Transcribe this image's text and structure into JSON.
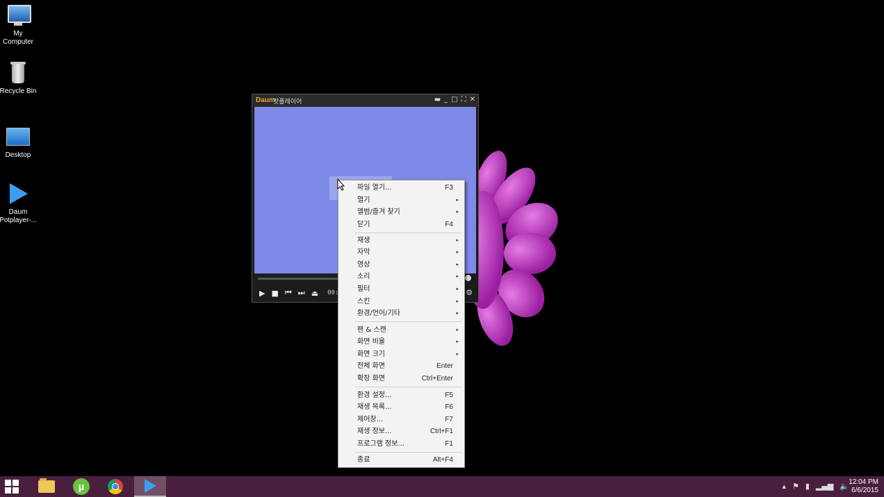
{
  "desktop": {
    "icons": [
      {
        "label1": "My",
        "label2": "Computer"
      },
      {
        "label1": "Recycle Bin",
        "label2": ""
      },
      {
        "label1": "Desktop",
        "label2": ""
      },
      {
        "label1": "Daum",
        "label2": "Potplayer-..."
      }
    ]
  },
  "player": {
    "title": "팟플레이어",
    "time": "00:00:0"
  },
  "menu": {
    "items": [
      {
        "label": "파일 열기...",
        "shortcut": "F3"
      },
      {
        "label": "열기",
        "arrow": "▸"
      },
      {
        "label": "앨범/즐겨 찾기",
        "arrow": "▸"
      },
      {
        "label": "닫기",
        "shortcut": "F4"
      },
      {
        "label": "재생",
        "arrow": "▸"
      },
      {
        "label": "자막",
        "arrow": "▸"
      },
      {
        "label": "영상",
        "arrow": "▸"
      },
      {
        "label": "소리",
        "arrow": "▸"
      },
      {
        "label": "필터",
        "arrow": "▸"
      },
      {
        "label": "스킨",
        "arrow": "▸"
      },
      {
        "label": "환경/언어/기타",
        "arrow": "▸"
      },
      {
        "label": "팬 & 스캔",
        "arrow": "▸"
      },
      {
        "label": "화면 비율",
        "arrow": "▸"
      },
      {
        "label": "화면 크기",
        "arrow": "▸"
      },
      {
        "label": "전체 화면",
        "shortcut": "Enter"
      },
      {
        "label": "확장 화면",
        "shortcut": "Ctrl+Enter"
      },
      {
        "label": "환경 설정...",
        "shortcut": "F5"
      },
      {
        "label": "재생 목록...",
        "shortcut": "F6"
      },
      {
        "label": "제어창...",
        "shortcut": "F7"
      },
      {
        "label": "재생 정보...",
        "shortcut": "Ctrl+F1"
      },
      {
        "label": "프로그램 정보...",
        "shortcut": "F1"
      },
      {
        "label": "종료",
        "shortcut": "Alt+F4"
      }
    ]
  },
  "taskbar": {
    "clock_time": "12:04 PM",
    "clock_date": "6/6/2015"
  }
}
